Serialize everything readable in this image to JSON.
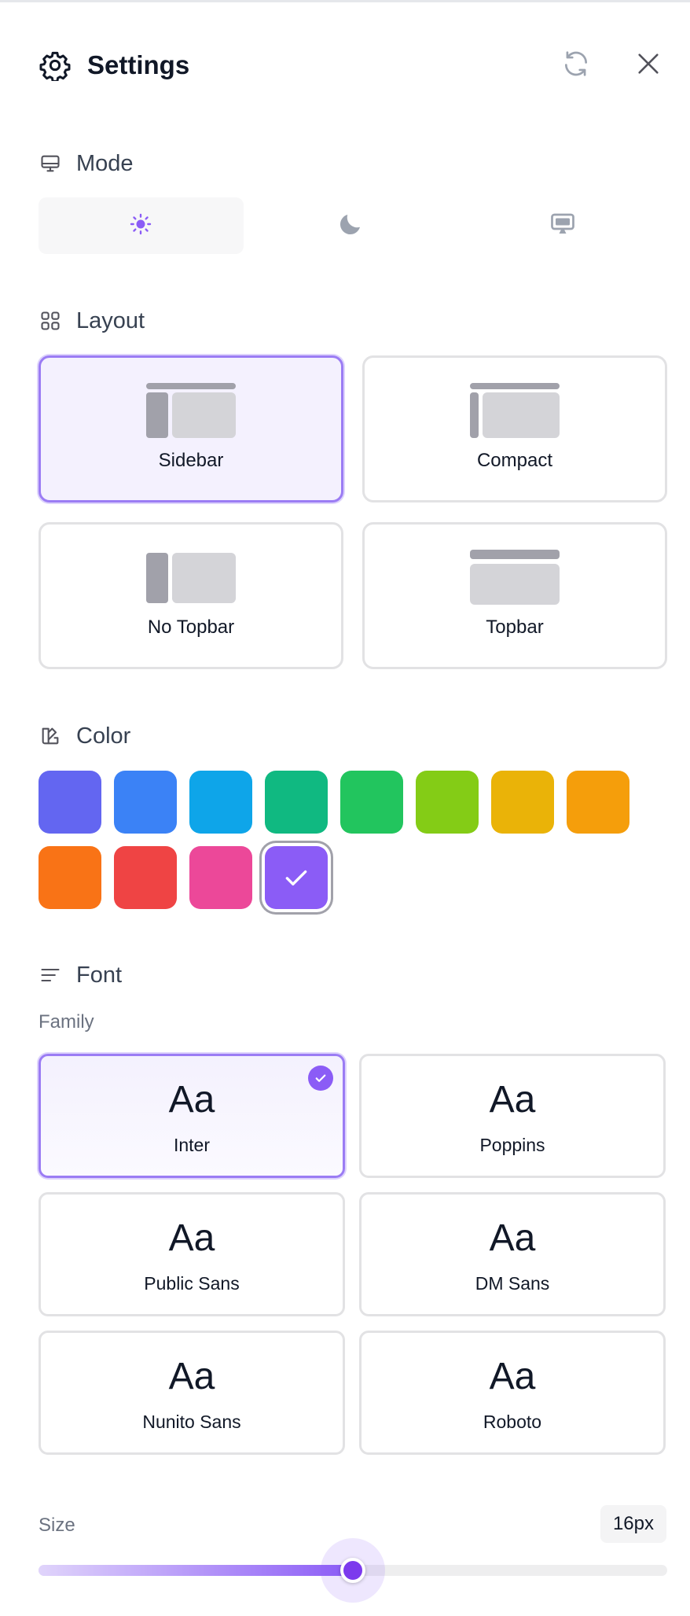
{
  "header": {
    "title": "Settings",
    "icons": {
      "settings": "gear-icon",
      "reset": "refresh-icon",
      "close": "close-icon"
    }
  },
  "mode": {
    "heading": "Mode",
    "icon": "monitor-icon",
    "options": [
      {
        "id": "light",
        "icon": "sun-icon",
        "active": true
      },
      {
        "id": "dark",
        "icon": "moon-icon",
        "active": false
      },
      {
        "id": "system",
        "icon": "monitor-icon",
        "active": false
      }
    ],
    "accent": "#8b5cf6"
  },
  "layout": {
    "heading": "Layout",
    "icon": "grid-icon",
    "options": [
      {
        "label": "Sidebar",
        "active": true
      },
      {
        "label": "Compact",
        "active": false
      },
      {
        "label": "No Topbar",
        "active": false
      },
      {
        "label": "Topbar",
        "active": false
      }
    ]
  },
  "color": {
    "heading": "Color",
    "icon": "palette-icon",
    "swatches": [
      "#6366f1",
      "#3b82f6",
      "#0ea5e9",
      "#10b981",
      "#22c55e",
      "#84cc16",
      "#eab308",
      "#f59e0b",
      "#f97316",
      "#ef4444",
      "#ec4899",
      "#8b5cf6"
    ],
    "selected": "#8b5cf6"
  },
  "font": {
    "heading": "Font",
    "icon": "text-lines-icon",
    "family_label": "Family",
    "sample": "Aa",
    "families": [
      {
        "label": "Inter",
        "active": true
      },
      {
        "label": "Poppins",
        "active": false
      },
      {
        "label": "Public Sans",
        "active": false
      },
      {
        "label": "DM Sans",
        "active": false
      },
      {
        "label": "Nunito Sans",
        "active": false
      },
      {
        "label": "Roboto",
        "active": false
      }
    ],
    "size_label": "Size",
    "size_value": "16px",
    "size_fraction": 0.5
  }
}
